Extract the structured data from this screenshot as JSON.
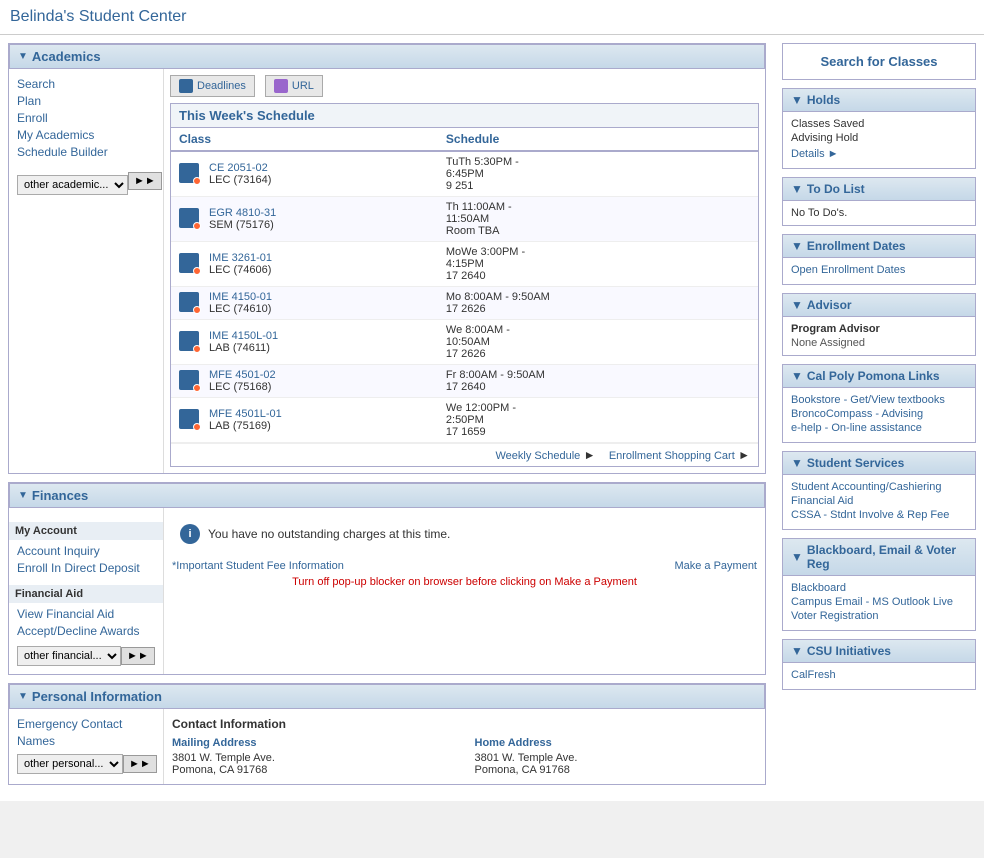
{
  "page": {
    "title": "Belinda's Student Center"
  },
  "academics": {
    "header": "Academics",
    "nav_links": [
      "Search",
      "Plan",
      "Enroll",
      "My Academics",
      "Schedule Builder"
    ],
    "dropdown_options": [
      "other academic..."
    ],
    "toolbar": {
      "deadlines_label": "Deadlines",
      "url_label": "URL"
    },
    "schedule": {
      "title": "This Week's Schedule",
      "col_class": "Class",
      "col_schedule": "Schedule",
      "rows": [
        {
          "class_code": "CE 2051-02",
          "class_type": "LEC (73164)",
          "schedule": "TuTh 5:30PM -\n6:45PM",
          "room": "9 251"
        },
        {
          "class_code": "EGR 4810-31",
          "class_type": "SEM (75176)",
          "schedule": "Th 11:00AM -\n11:50AM",
          "room": "Room  TBA"
        },
        {
          "class_code": "IME 3261-01",
          "class_type": "LEC (74606)",
          "schedule": "MoWe 3:00PM -\n4:15PM",
          "room": "17 2640"
        },
        {
          "class_code": "IME 4150-01",
          "class_type": "LEC (74610)",
          "schedule": "Mo 8:00AM - 9:50AM",
          "room": "17 2626"
        },
        {
          "class_code": "IME 4150L-01",
          "class_type": "LAB (74611)",
          "schedule": "We 8:00AM -\n10:50AM",
          "room": "17 2626"
        },
        {
          "class_code": "MFE 4501-02",
          "class_type": "LEC (75168)",
          "schedule": "Fr 8:00AM - 9:50AM",
          "room": "17 2640"
        },
        {
          "class_code": "MFE 4501L-01",
          "class_type": "LAB (75169)",
          "schedule": "We 12:00PM -\n2:50PM",
          "room": "17 1659"
        }
      ],
      "weekly_schedule_link": "Weekly Schedule",
      "enrollment_cart_link": "Enrollment Shopping Cart"
    }
  },
  "finances": {
    "header": "Finances",
    "my_account_label": "My Account",
    "nav_links": [
      "Account Inquiry",
      "Enroll In Direct Deposit"
    ],
    "financial_aid_label": "Financial Aid",
    "fin_links": [
      "View Financial Aid",
      "Accept/Decline Awards"
    ],
    "dropdown_options": [
      "other financial..."
    ],
    "no_charges_msg": "You have no outstanding charges at this time.",
    "fee_info_link": "*Important Student Fee Information",
    "make_payment_link": "Make a Payment",
    "popup_warning": "Turn off pop-up blocker on browser before clicking on Make a Payment"
  },
  "personal": {
    "header": "Personal Information",
    "nav_links": [
      "Emergency Contact",
      "Names"
    ],
    "dropdown_options": [
      "other personal..."
    ],
    "contact": {
      "header": "Contact Information",
      "mailing_label": "Mailing Address",
      "mailing_addr1": "3801 W. Temple Ave.",
      "mailing_addr2": "Pomona, CA 91768",
      "home_label": "Home Address",
      "home_addr1": "3801 W. Temple Ave.",
      "home_addr2": "Pomona, CA 91768"
    }
  },
  "right": {
    "search_classes": "Search for Classes",
    "holds": {
      "header": "Holds",
      "items": [
        "Classes Saved",
        "Advising Hold"
      ],
      "details_link": "Details"
    },
    "todo": {
      "header": "To Do List",
      "message": "No To Do's."
    },
    "enrollment_dates": {
      "header": "Enrollment Dates",
      "link": "Open Enrollment Dates"
    },
    "advisor": {
      "header": "Advisor",
      "program_advisor_label": "Program Advisor",
      "program_advisor_value": "None Assigned"
    },
    "cal_poly_links": {
      "header": "Cal Poly Pomona Links",
      "links": [
        "Bookstore - Get/View textbooks",
        "BroncoCompass - Advising",
        "e-help - On-line assistance"
      ]
    },
    "student_services": {
      "header": "Student Services",
      "links": [
        "Student Accounting/Cashiering",
        "Financial Aid",
        "CSSA - Stdnt Involve & Rep Fee"
      ]
    },
    "blackboard": {
      "header": "Blackboard, Email & Voter Reg",
      "links": [
        "Blackboard",
        "Campus Email - MS Outlook Live",
        "Voter Registration"
      ]
    },
    "csu": {
      "header": "CSU Initiatives",
      "links": [
        "CalFresh"
      ]
    }
  }
}
